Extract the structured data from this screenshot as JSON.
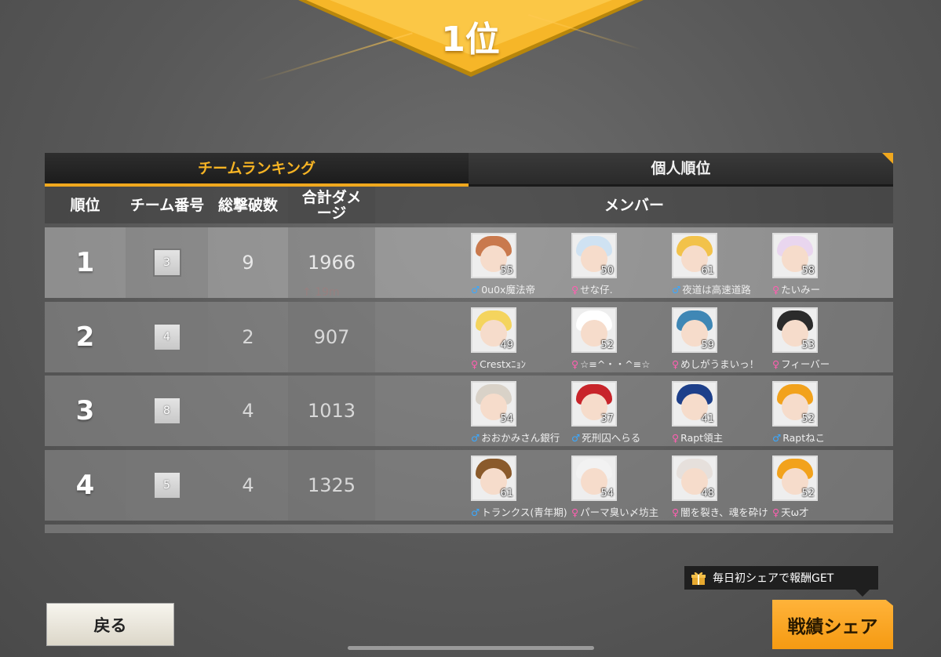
{
  "banner": {
    "rank_label": "1位"
  },
  "tabs": {
    "team": "チームランキング",
    "personal": "個人順位"
  },
  "columns": {
    "rank": "順位",
    "team_no": "チーム番号",
    "kills": "総撃破数",
    "damage_line1": "合計ダメ",
    "damage_line2": "ージ",
    "members": "メンバー"
  },
  "float_text": "19m",
  "rows": [
    {
      "rank": "1",
      "team": "3",
      "kills": "9",
      "damage": "1966",
      "members": [
        {
          "level": "55",
          "gender": "♂",
          "name": "0u0x魔法帝"
        },
        {
          "level": "50",
          "gender": "♀",
          "name": "せな仔."
        },
        {
          "level": "61",
          "gender": "♂",
          "name": "夜道は高速道路"
        },
        {
          "level": "58",
          "gender": "♀",
          "name": "たいみー"
        }
      ]
    },
    {
      "rank": "2",
      "team": "4",
      "kills": "2",
      "damage": "907",
      "members": [
        {
          "level": "49",
          "gender": "♀",
          "name": "Crestxﾆｮﾝ"
        },
        {
          "level": "52",
          "gender": "♀",
          "name": "☆≡^・・^≡☆"
        },
        {
          "level": "59",
          "gender": "♀",
          "name": "めしがうまいっ！"
        },
        {
          "level": "53",
          "gender": "♀",
          "name": "フィーバー"
        }
      ]
    },
    {
      "rank": "3",
      "team": "8",
      "kills": "4",
      "damage": "1013",
      "members": [
        {
          "level": "54",
          "gender": "♂",
          "name": "おおかみさん銀行"
        },
        {
          "level": "37",
          "gender": "♂",
          "name": "死刑囚へらる"
        },
        {
          "level": "41",
          "gender": "♀",
          "name": "Rapt領主"
        },
        {
          "level": "52",
          "gender": "♂",
          "name": "Raptねこ"
        }
      ]
    },
    {
      "rank": "4",
      "team": "5",
      "kills": "4",
      "damage": "1325",
      "members": [
        {
          "level": "61",
          "gender": "♂",
          "name": "トランクス(青年期)"
        },
        {
          "level": "54",
          "gender": "♀",
          "name": "パーマ臭い〆坊主"
        },
        {
          "level": "48",
          "gender": "♀",
          "name": "闇を裂き、魂を砕け"
        },
        {
          "level": "52",
          "gender": "♀",
          "name": "天ω才"
        }
      ]
    }
  ],
  "buttons": {
    "back": "戻る",
    "share": "戦績シェア"
  },
  "notice": "毎日初シェアで報酬GET",
  "colors": {
    "accent": "#f0a81e",
    "male": "#3aa8ff",
    "female": "#ff5fb0"
  }
}
